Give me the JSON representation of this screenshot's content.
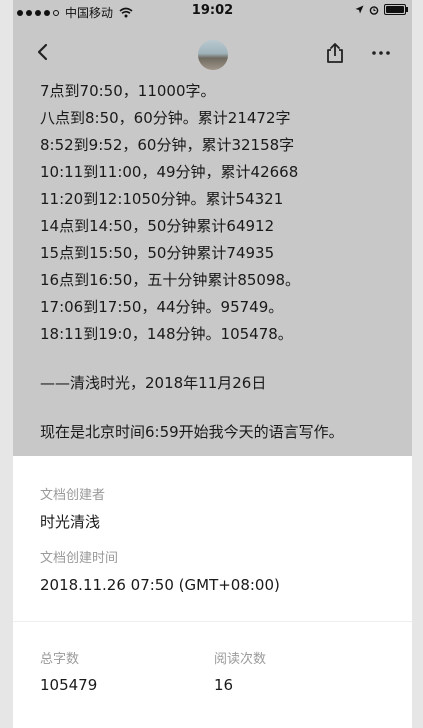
{
  "status_bar": {
    "carrier": "中国移动",
    "time": "19:02"
  },
  "nav": {
    "back_icon": "chevron-left-icon",
    "share_icon": "share-icon",
    "more_icon": "more-icon"
  },
  "content_lines": [
    "7点到70:50，11000字。",
    "八点到8:50，60分钟。累计21472字",
    "8:52到9:52，60分钟，累计32158字",
    "10:11到11:00，49分钟，累计42668",
    "11:20到12:1050分钟。累计54321",
    "14点到14:50，50分钟累计64912",
    "15点到15:50，50分钟累计74935",
    "16点到16:50，五十分钟累计85098。",
    "17:06到17:50，44分钟。95749。",
    "18:11到19:0，148分钟。105478。"
  ],
  "signature": "——清浅时光，2018年11月26日",
  "intro": "现在是北京时间6:59开始我今天的语言写作。",
  "doc_info": {
    "creator_label": "文档创建者",
    "creator_value": "时光清浅",
    "created_time_label": "文档创建时间",
    "created_time_value": "2018.11.26 07:50 (GMT+08:00)",
    "word_count_label": "总字数",
    "word_count_value": "105479",
    "read_count_label": "阅读次数",
    "read_count_value": "16"
  }
}
